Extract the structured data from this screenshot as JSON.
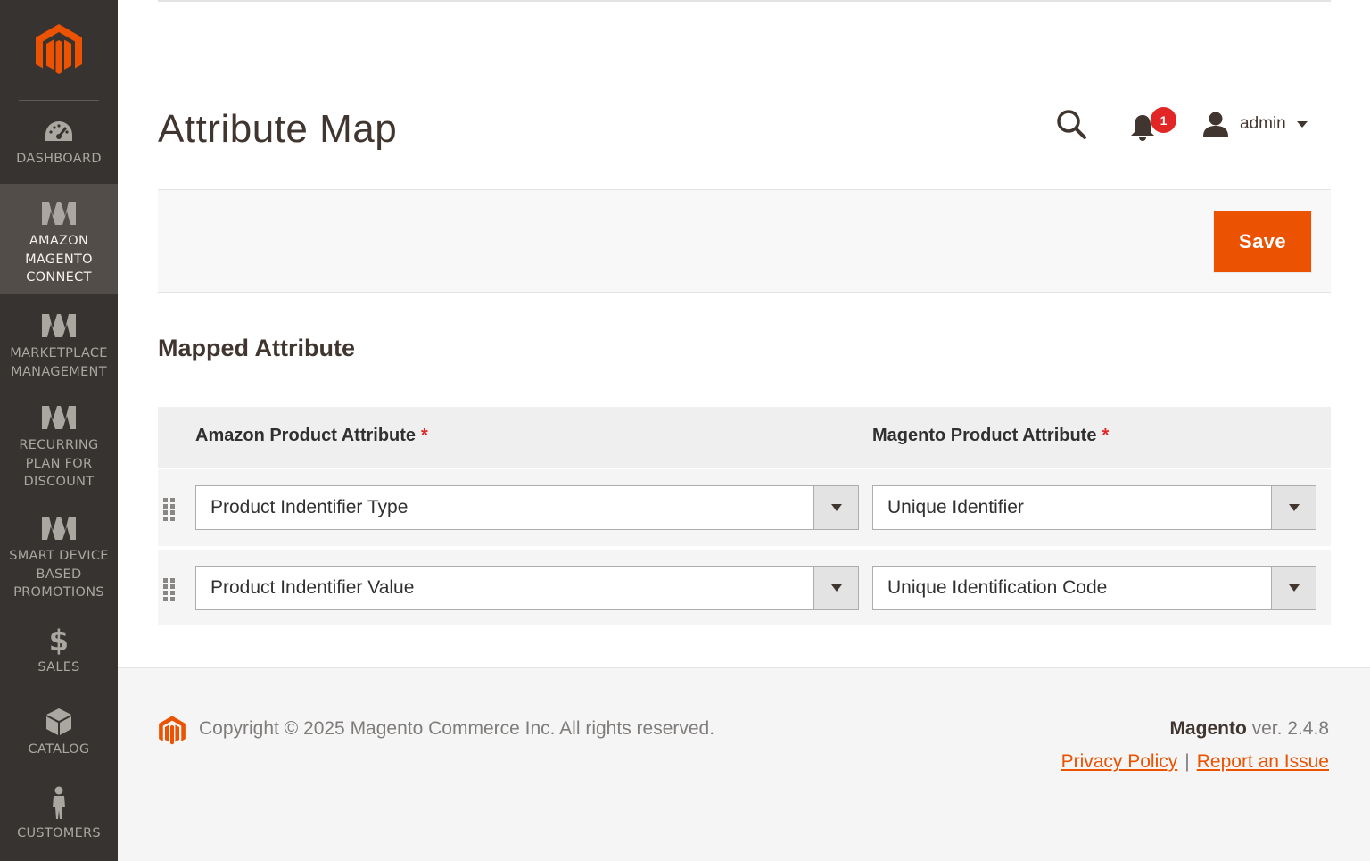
{
  "app": {
    "title": "Attribute Map"
  },
  "colors": {
    "sidebar": "#373330",
    "accent": "#eb5202",
    "badge": "#e22626"
  },
  "sidebar": {
    "logo": "magento-logo",
    "items": [
      {
        "label": "DASHBOARD",
        "icon": "speedometer-icon",
        "active": false
      },
      {
        "label": "AMAZON\nMAGENTO\nCONNECT",
        "icon": "w-logo-icon",
        "active": true
      },
      {
        "label": "MARKETPLACE\nMANAGEMENT",
        "icon": "w-logo-icon",
        "active": false
      },
      {
        "label": "RECURRING\nPLAN FOR\nDISCOUNT",
        "icon": "w-logo-icon",
        "active": false
      },
      {
        "label": "SMART DEVICE\nBASED\nPROMOTIONS",
        "icon": "w-logo-icon",
        "active": false
      },
      {
        "label": "SALES",
        "icon": "dollar-icon",
        "active": false
      },
      {
        "label": "CATALOG",
        "icon": "box-icon",
        "active": false
      },
      {
        "label": "CUSTOMERS",
        "icon": "person-icon",
        "active": false
      }
    ]
  },
  "header": {
    "notifications_count": "1",
    "user": "admin"
  },
  "actions": {
    "save_label": "Save"
  },
  "section": {
    "title": "Mapped Attribute"
  },
  "grid": {
    "columns": [
      "Amazon Product Attribute",
      "Magento Product Attribute"
    ],
    "required_marker": "*",
    "rows": [
      {
        "amazon": "Product Indentifier Type",
        "magento": "Unique Identifier"
      },
      {
        "amazon": "Product Indentifier Value",
        "magento": "Unique Identification Code"
      }
    ]
  },
  "footer": {
    "copyright": "Copyright © 2025 Magento Commerce Inc. All rights reserved.",
    "brand": "Magento",
    "version": "ver. 2.4.8",
    "privacy": "Privacy Policy",
    "separator": "|",
    "report": "Report an Issue"
  }
}
